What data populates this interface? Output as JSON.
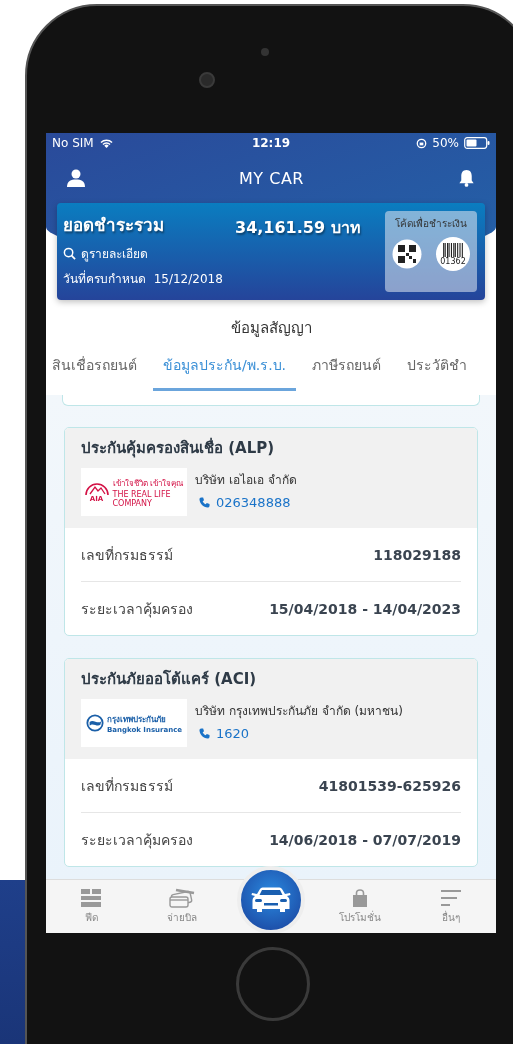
{
  "status_bar": {
    "carrier": "No SIM",
    "time": "12:19",
    "battery": "50%"
  },
  "header": {
    "title": "MY CAR"
  },
  "summary": {
    "label": "ยอดชำระรวม",
    "amount": "34,161.59 บาท",
    "details_link": "ดูรายละเอียด",
    "due_label": "วันที่ครบกำหนด",
    "due_date": "15/12/2018",
    "pay_code": {
      "title": "โค้ดเพื่อชำระเงิน",
      "barcode_number": "01362"
    }
  },
  "section_title": "ข้อมูลสัญญา",
  "tabs": [
    {
      "label": "สินเชื่อรถยนต์",
      "selected": false
    },
    {
      "label": "ข้อมูลประกัน/พ.ร.บ.",
      "selected": true
    },
    {
      "label": "ภาษีรถยนต์",
      "selected": false
    },
    {
      "label": "ประวัติชำ",
      "selected": false
    }
  ],
  "policies": [
    {
      "title": "ประกันคุ้มครองสินเชื่อ (ALP)",
      "logo": {
        "kind": "aia",
        "mark": "AIA",
        "line_1": "เข้าใจชีวิต เข้าใจคุณ",
        "line_2": "THE REAL LIFE COMPANY"
      },
      "company": "บริษัท เอไอเอ จำกัด",
      "phone": "026348888",
      "rows": [
        {
          "label": "เลขที่กรมธรรม์",
          "value": "118029188"
        },
        {
          "label": "ระยะเวลาคุ้มครอง",
          "value": "15/04/2018 - 14/04/2023"
        }
      ]
    },
    {
      "title": "ประกันภัยออโต้แคร์ (ACI)",
      "logo": {
        "kind": "bki",
        "line_1": "กรุงเทพประกันภัย",
        "line_2": "Bangkok Insurance"
      },
      "company": "บริษัท กรุงเทพประกันภัย จำกัด (มหาชน)",
      "phone": "1620",
      "rows": [
        {
          "label": "เลขที่กรมธรรม์",
          "value": "41801539-625926"
        },
        {
          "label": "ระยะเวลาคุ้มครอง",
          "value": "14/06/2018 - 07/07/2019"
        }
      ]
    }
  ],
  "bottom_nav": [
    {
      "kind": "feed",
      "label": "ฟีด"
    },
    {
      "kind": "bills",
      "label": "จ่ายบิล"
    },
    {
      "kind": "car"
    },
    {
      "kind": "promotions",
      "label": "โปรโมชั่น"
    },
    {
      "kind": "more",
      "label": "อื่นๆ"
    }
  ]
}
